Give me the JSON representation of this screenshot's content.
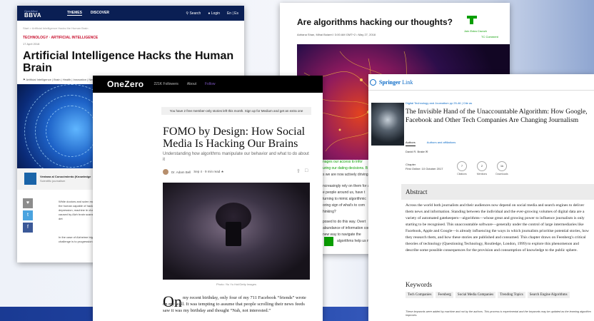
{
  "bbva": {
    "brand_top": "OpenMind",
    "brand": "BBVA",
    "nav": [
      "THEMES",
      "DISCOVER"
    ],
    "search": "Search",
    "login": "Login",
    "lang": "En | Es",
    "breadcrumb": "Start > Artificial Intelligence Hacks the Human Brain",
    "category": "TECHNOLOGY · ARTIFICIAL INTELLIGENCE",
    "date": "17 April 2018",
    "title": "Artificial Intelligence Hacks the Human Brain",
    "tags": "Artificial Intelligence | Brain | Health | Innovation | Neuro",
    "author_name": "Ventana al Conocimiento (Knowledge",
    "author_role": "Scientific journalism",
    "body1": "While doctors and scien machinery of the human capable of hacking it. depression; machine le changes caused by Alzh brain scans that can det",
    "body2": "In the case of Alzheime biggest challenge is to progression. According"
  },
  "tc": {
    "title": "Are algorithms hacking our thoughts?",
    "byline": "Adriana Shan, Mihai Boiarel  / 3:00 AM GMT+2 • May 27, 2018",
    "logo_text": "Join Extra Crunch",
    "logo_sub": "TC Comment",
    "lines": [
      "nages our access to infor",
      "uring our dating decisions. B",
      "s we are now actively driving",
      "ncreasingly rely on them for a",
      "e people around us, have t",
      "turning to mimic algorithmic",
      "oring sign of what's to com",
      "hinking?",
      "posed to do this way. Overt",
      "abundance of information com",
      "new way to navigate the",
      "algorithms help us m"
    ]
  },
  "oz": {
    "brand": "OneZero",
    "followers": "221K Followers",
    "about": "About",
    "follow": "Follow",
    "banner": "You have 2 free member-only stories left this month. Sign up for Medium and get an extra one",
    "title": "FOMO by Design: How Social Media Is Hacking Our Brains",
    "subtitle": "Understanding how algorithms manipulate our behavior and what to do about it",
    "author": "Dr. Adam Bell",
    "meta": "Sep 4 · 9 min read ★",
    "caption": "Photo: Yiu Yu Hoi/Getty Images",
    "dropcap": "On",
    "body": "my recent birthday, only four of my 711 Facebook “friends” wrote on my wall. It was tempting to assume that people scrolling their news feeds saw it was my birthday and thought “Nah, not interested.”"
  },
  "sp": {
    "logo": "Springer",
    "logo_link": "Link",
    "journal": "Digital Technology and Journalism pp 25-46 | Cite as",
    "title": "The Invisible Hand of the Unaccountable Algorithm: How Google, Facebook and Other Tech Companies Are Changing Journalism",
    "tab_active": "Authors",
    "tab_link": "Authors and affiliations",
    "author": "David R. Brake",
    "chapter": "Chapter",
    "first_online": "First Online: 10 October 2017",
    "metrics": [
      {
        "value": "7",
        "label": "Citations"
      },
      {
        "value": "2",
        "label": "Mentions"
      },
      {
        "value": "1k",
        "label": "Downloads"
      }
    ],
    "abstract_head": "Abstract",
    "abstract": "Across the world both journalists and their audiences now depend on social media and search engines to deliver them news and information. Standing between the individual and the ever-growing volumes of digital data are a variety of automated gatekeepers—algorithms—whose great and growing power to influence journalism is only starting to be recognised. This unaccountable software—generally under the control of large intermediaries like Facebook, Apple and Google—is already influencing the ways in which journalists prioritise potential stories, how they research them, and how these stories are published and consumed. This chapter draws on Feenberg's critical theories of technology (Questioning Technology, Routledge, London, 1999) to explore this phenomenon and describe some possible consequences for the provision and consumption of knowledge to the public sphere.",
    "keywords_head": "Keywords",
    "keywords": [
      "Tech Companies",
      "Feenberg",
      "Social Media Companies",
      "Trending Topics",
      "Search Engine Algorithms"
    ],
    "note": "These keywords were added by machine and not by the authors. This process is experimental and the keywords may be updated as the learning algorithm improves."
  }
}
